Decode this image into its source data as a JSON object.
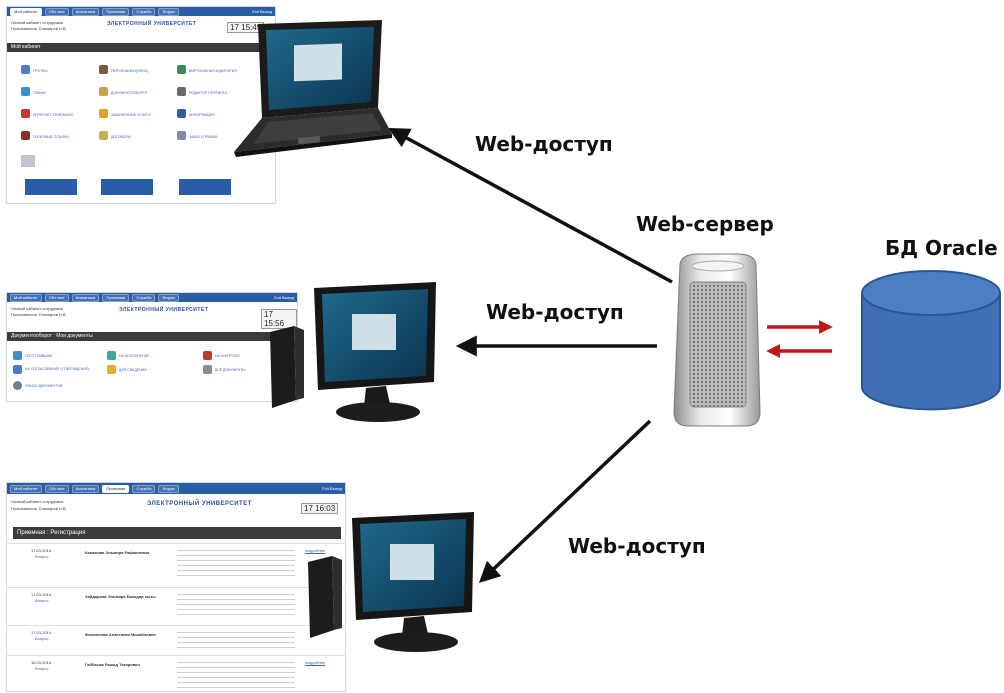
{
  "labels": {
    "web_access_1": "Web-доступ",
    "web_access_2": "Web-доступ",
    "web_access_3": "Web-доступ",
    "web_server": "Web-сервер",
    "database": "БД Oracle"
  },
  "screens": {
    "screen1": {
      "tabs": [
        "Мой кабинет",
        "Обо мне",
        "Аналитика",
        "Приемная",
        "Службы",
        "Форум"
      ],
      "nav_right": "Exit   Выход",
      "line1": "Личный кабинет сотрудника",
      "line2": "Пользователь: Ельмаров Н.В.",
      "logo": "ЭЛЕКТРОННЫЙ УНИВЕРСИТЕТ",
      "clock": "17 15:49",
      "bar": "Мой кабинет",
      "icons": [
        "ГРУППЫ",
        "ПЕРСОНАЛИИ(ОФИС)",
        "ВИРТУАЛЬНАЯ АУДИТОРИЯ",
        "ПЛАНЫ",
        "ДОКУМЕНТООБОРОТ",
        "РЕДАКТОР РЕЙТИНГА",
        "ИНТЕРНЕТ-ПРИЕМНАЯ",
        "ЗАМЕНЕННЫЕ УСЛУГИ",
        "ИНФОРМАЦИЯ",
        "ПОЛЕЗНЫЕ ССЫЛКИ",
        "ДОГОВОРЫ",
        "ЗАКАЗ СПРАВКИ"
      ]
    },
    "screen2": {
      "tabs": [
        "Мой кабинет",
        "Обо мне",
        "Аналитика",
        "Приемная",
        "Службы",
        "Форум"
      ],
      "nav_right": "Exit   Выход",
      "line1": "Личный кабинет сотрудника",
      "line2": "Пользователь: Ельмаров Н.В.",
      "logo": "ЭЛЕКТРОННЫЙ УНИВЕРСИТЕТ",
      "clock": "17 15:56",
      "bar": "Документооборот : Мои документы",
      "icons": [
        "ПОСТУПИВШИЕ",
        "НА ИСПОЛНЕНИЕ",
        "НА КОНТРОЛЕ",
        "НА СОГЛАСОВАНИЕ (УТВЕРЖДЕНИЕ)",
        "ДЛЯ СВЕДЕНИЯ",
        "ВСЕ ДОКУМЕНТЫ",
        "ПОИСК ДОКУМЕНТОВ"
      ]
    },
    "screen3": {
      "tabs": [
        "Мой кабинет",
        "Обо мне",
        "Аналитика",
        "Приемная",
        "Службы",
        "Форум"
      ],
      "nav_right": "Exit   Выход",
      "line1": "Личный кабинет сотрудника",
      "line2": "Пользователь: Ельмаров Н.В.",
      "logo": "ЭЛЕКТРОННЫЙ УНИВЕРСИТЕТ",
      "clock": "17 16:03",
      "bar": "Приемная : Регистрация",
      "rows": [
        {
          "date": "17.03.2014",
          "type": "Вопрос",
          "name": "Камалова Эльмира Рафаилевна",
          "link": "подробнее"
        },
        {
          "date": "17.03.2014",
          "type": "Вопрос",
          "name": "Хайдарова Эльмира Баходир кызы",
          "link": ""
        },
        {
          "date": "17.03.2014",
          "type": "Вопрос",
          "name": "Филиппова Анастасия Михайловна",
          "link": ""
        },
        {
          "date": "16.03.2014",
          "type": "Вопрос",
          "name": "Габбасов Рашид Тагирович",
          "link": "подробнее"
        }
      ]
    }
  },
  "colors": {
    "arrow_black": "#111111",
    "arrow_red": "#c0171b",
    "db_blue": "#3f70b3",
    "nav_blue": "#2a5da8"
  }
}
